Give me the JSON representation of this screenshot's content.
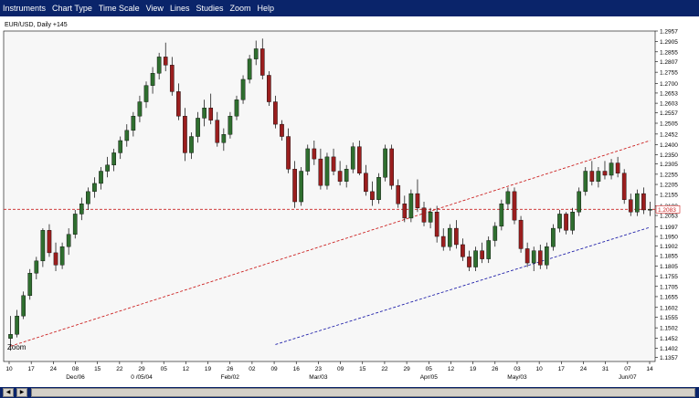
{
  "menu": {
    "items": [
      "Instruments",
      "Chart Type",
      "Time Scale",
      "View",
      "Lines",
      "Studies",
      "Zoom",
      "Help"
    ]
  },
  "chart_header": "EUR/USD, Daily +145",
  "zoom_label": "Zoom",
  "colors": {
    "up": "#2f6e2f",
    "down": "#9a1e1e",
    "wick": "#000000",
    "trendline_red": "#cc2222",
    "trendline_blue": "#2222aa",
    "price_line": "#cc2222",
    "price_box": "#cc2222",
    "menubar": "#0a246a"
  },
  "chart_data": {
    "type": "candlestick",
    "title": "EUR/USD, Daily +145",
    "ylim": [
      1.1337,
      1.2957
    ],
    "y_ticks": [
      "1.2957",
      "1.2905",
      "1.2855",
      "1.2807",
      "1.2755",
      "1.2700",
      "1.2653",
      "1.2603",
      "1.2557",
      "1.2505",
      "1.2452",
      "1.2400",
      "1.2350",
      "1.2305",
      "1.2255",
      "1.2205",
      "1.2155",
      "1.2100",
      "1.2053",
      "1.1997",
      "1.1950",
      "1.1902",
      "1.1855",
      "1.1805",
      "1.1755",
      "1.1705",
      "1.1655",
      "1.1602",
      "1.1555",
      "1.1502",
      "1.1452",
      "1.1402",
      "1.1357"
    ],
    "current_price": 1.2083,
    "current_price_label": "1.2083",
    "x_tick_labels": [
      "10",
      "17",
      "24",
      "08",
      "15",
      "22",
      "29",
      "05",
      "12",
      "19",
      "26",
      "02",
      "09",
      "16",
      "23",
      "09",
      "15",
      "22",
      "29",
      "05",
      "12",
      "19",
      "26",
      "03",
      "10",
      "17",
      "24",
      "31",
      "07",
      "14"
    ],
    "x_month_labels": [
      "Dec/06",
      "0 /05/04",
      "Feb/02",
      "Mar/03",
      "Apr/05",
      "May/03",
      "Jun/07"
    ],
    "candles": [
      [
        1.145,
        1.156,
        1.139,
        1.147
      ],
      [
        1.147,
        1.159,
        1.1455,
        1.156
      ],
      [
        1.156,
        1.168,
        1.1545,
        1.166
      ],
      [
        1.166,
        1.179,
        1.164,
        1.177
      ],
      [
        1.177,
        1.185,
        1.174,
        1.183
      ],
      [
        1.183,
        1.199,
        1.18,
        1.198
      ],
      [
        1.198,
        1.201,
        1.185,
        1.187
      ],
      [
        1.187,
        1.192,
        1.178,
        1.181
      ],
      [
        1.181,
        1.192,
        1.179,
        1.19
      ],
      [
        1.19,
        1.199,
        1.186,
        1.196
      ],
      [
        1.196,
        1.208,
        1.194,
        1.206
      ],
      [
        1.206,
        1.214,
        1.203,
        1.211
      ],
      [
        1.211,
        1.219,
        1.208,
        1.217
      ],
      [
        1.217,
        1.224,
        1.214,
        1.221
      ],
      [
        1.221,
        1.229,
        1.218,
        1.227
      ],
      [
        1.227,
        1.234,
        1.224,
        1.23
      ],
      [
        1.23,
        1.238,
        1.227,
        1.236
      ],
      [
        1.236,
        1.244,
        1.233,
        1.242
      ],
      [
        1.242,
        1.25,
        1.239,
        1.247
      ],
      [
        1.247,
        1.256,
        1.244,
        1.254
      ],
      [
        1.254,
        1.264,
        1.251,
        1.261
      ],
      [
        1.261,
        1.271,
        1.258,
        1.269
      ],
      [
        1.269,
        1.278,
        1.265,
        1.275
      ],
      [
        1.275,
        1.285,
        1.272,
        1.283
      ],
      [
        1.283,
        1.29,
        1.276,
        1.279
      ],
      [
        1.279,
        1.283,
        1.264,
        1.266
      ],
      [
        1.266,
        1.27,
        1.252,
        1.254
      ],
      [
        1.254,
        1.258,
        1.232,
        1.236
      ],
      [
        1.236,
        1.246,
        1.233,
        1.244
      ],
      [
        1.244,
        1.256,
        1.241,
        1.253
      ],
      [
        1.253,
        1.262,
        1.249,
        1.258
      ],
      [
        1.258,
        1.265,
        1.25,
        1.252
      ],
      [
        1.252,
        1.256,
        1.239,
        1.241
      ],
      [
        1.241,
        1.248,
        1.237,
        1.245
      ],
      [
        1.245,
        1.256,
        1.243,
        1.254
      ],
      [
        1.254,
        1.264,
        1.252,
        1.262
      ],
      [
        1.262,
        1.274,
        1.26,
        1.272
      ],
      [
        1.272,
        1.284,
        1.27,
        1.282
      ],
      [
        1.282,
        1.291,
        1.279,
        1.287
      ],
      [
        1.287,
        1.292,
        1.272,
        1.274
      ],
      [
        1.274,
        1.276,
        1.259,
        1.261
      ],
      [
        1.261,
        1.264,
        1.248,
        1.25
      ],
      [
        1.25,
        1.252,
        1.242,
        1.244
      ],
      [
        1.244,
        1.248,
        1.226,
        1.228
      ],
      [
        1.228,
        1.232,
        1.209,
        1.212
      ],
      [
        1.212,
        1.229,
        1.21,
        1.227
      ],
      [
        1.227,
        1.24,
        1.225,
        1.238
      ],
      [
        1.238,
        1.242,
        1.23,
        1.233
      ],
      [
        1.233,
        1.238,
        1.218,
        1.22
      ],
      [
        1.22,
        1.236,
        1.218,
        1.234
      ],
      [
        1.234,
        1.238,
        1.225,
        1.227
      ],
      [
        1.227,
        1.232,
        1.22,
        1.222
      ],
      [
        1.222,
        1.23,
        1.219,
        1.228
      ],
      [
        1.228,
        1.241,
        1.226,
        1.239
      ],
      [
        1.239,
        1.242,
        1.225,
        1.226
      ],
      [
        1.226,
        1.23,
        1.215,
        1.217
      ],
      [
        1.217,
        1.222,
        1.21,
        1.213
      ],
      [
        1.213,
        1.226,
        1.211,
        1.224
      ],
      [
        1.224,
        1.24,
        1.222,
        1.238
      ],
      [
        1.238,
        1.24,
        1.218,
        1.22
      ],
      [
        1.22,
        1.223,
        1.209,
        1.211
      ],
      [
        1.211,
        1.215,
        1.202,
        1.204
      ],
      [
        1.204,
        1.218,
        1.202,
        1.216
      ],
      [
        1.216,
        1.223,
        1.207,
        1.209
      ],
      [
        1.209,
        1.212,
        1.2,
        1.202
      ],
      [
        1.202,
        1.209,
        1.199,
        1.207
      ],
      [
        1.207,
        1.21,
        1.192,
        1.195
      ],
      [
        1.195,
        1.199,
        1.188,
        1.19
      ],
      [
        1.19,
        1.201,
        1.188,
        1.199
      ],
      [
        1.199,
        1.203,
        1.189,
        1.191
      ],
      [
        1.191,
        1.194,
        1.183,
        1.185
      ],
      [
        1.185,
        1.188,
        1.178,
        1.18
      ],
      [
        1.18,
        1.19,
        1.178,
        1.188
      ],
      [
        1.188,
        1.192,
        1.182,
        1.184
      ],
      [
        1.184,
        1.195,
        1.182,
        1.193
      ],
      [
        1.193,
        1.202,
        1.19,
        1.2
      ],
      [
        1.2,
        1.213,
        1.198,
        1.211
      ],
      [
        1.211,
        1.219,
        1.208,
        1.217
      ],
      [
        1.217,
        1.219,
        1.201,
        1.203
      ],
      [
        1.203,
        1.205,
        1.187,
        1.189
      ],
      [
        1.189,
        1.192,
        1.18,
        1.182
      ],
      [
        1.182,
        1.19,
        1.178,
        1.188
      ],
      [
        1.188,
        1.191,
        1.179,
        1.181
      ],
      [
        1.181,
        1.192,
        1.179,
        1.19
      ],
      [
        1.19,
        1.201,
        1.188,
        1.199
      ],
      [
        1.199,
        1.208,
        1.197,
        1.206
      ],
      [
        1.206,
        1.207,
        1.196,
        1.198
      ],
      [
        1.198,
        1.209,
        1.196,
        1.207
      ],
      [
        1.207,
        1.219,
        1.205,
        1.217
      ],
      [
        1.217,
        1.229,
        1.215,
        1.227
      ],
      [
        1.227,
        1.232,
        1.22,
        1.222
      ],
      [
        1.222,
        1.229,
        1.219,
        1.227
      ],
      [
        1.227,
        1.232,
        1.223,
        1.225
      ],
      [
        1.225,
        1.233,
        1.223,
        1.231
      ],
      [
        1.231,
        1.234,
        1.224,
        1.226
      ],
      [
        1.226,
        1.228,
        1.211,
        1.213
      ],
      [
        1.213,
        1.216,
        1.205,
        1.207
      ],
      [
        1.207,
        1.218,
        1.205,
        1.216
      ],
      [
        1.216,
        1.219,
        1.206,
        1.208
      ],
      [
        1.208,
        1.212,
        1.205,
        1.2083
      ]
    ],
    "trendlines": [
      {
        "name": "upper",
        "color": "red",
        "from": [
          0,
          1.1412
        ],
        "to": [
          99,
          1.242
        ]
      },
      {
        "name": "lower",
        "color": "blue",
        "from": [
          41,
          1.142
        ],
        "to": [
          99,
          1.1995
        ]
      }
    ]
  }
}
